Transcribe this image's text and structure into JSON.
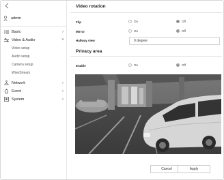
{
  "sidebar": {
    "user_label": "admin",
    "menu": {
      "basic": "Basic",
      "video_audio": "Video & Audio",
      "sub_items": [
        "Video setup",
        "Audio setup",
        "Camera setup",
        "WiseStream"
      ],
      "network": "Network",
      "event": "Event",
      "system": "System"
    }
  },
  "video_rotation": {
    "title": "Video rotation",
    "flip": {
      "label": "Flip",
      "on": "On",
      "off": "Off",
      "selected": "off"
    },
    "mirror": {
      "label": "Mirror",
      "on": "On",
      "off": "Off",
      "selected": "off"
    },
    "hallway_view": {
      "label": "Hallway view",
      "value": "0 degree"
    }
  },
  "privacy_area": {
    "title": "Privacy area",
    "enable": {
      "label": "Enable",
      "on": "On",
      "off": "Off",
      "selected": "off"
    }
  },
  "buttons": {
    "cancel": "Cancel",
    "apply": "Apply"
  }
}
